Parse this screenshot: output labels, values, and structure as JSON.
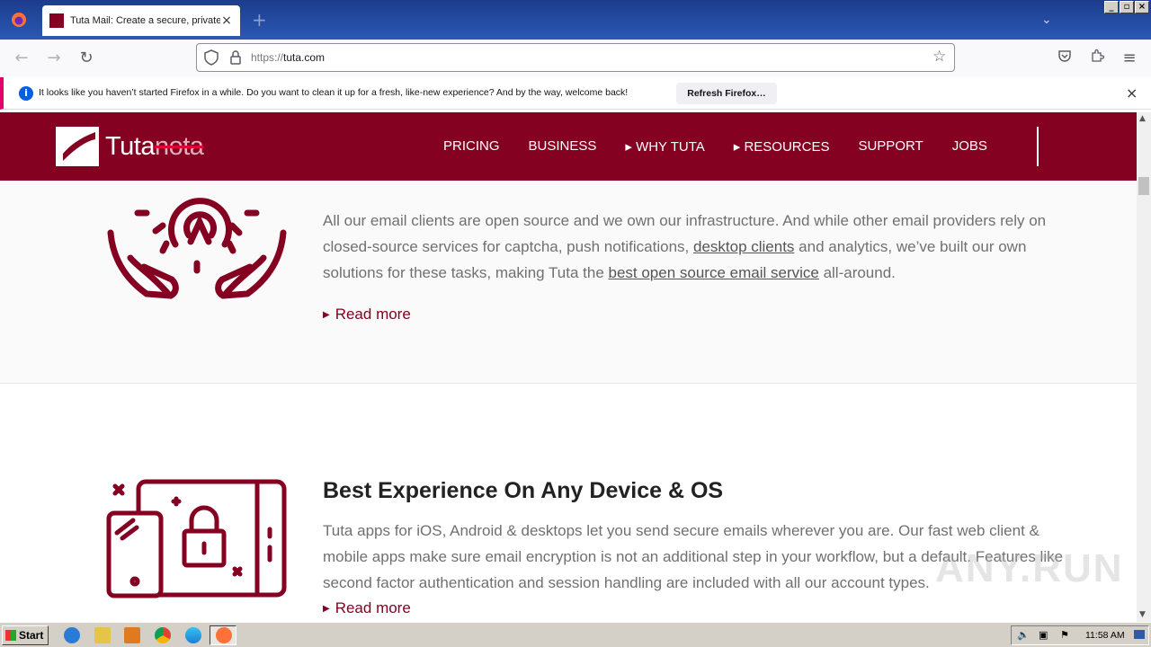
{
  "browser": {
    "tab_title": "Tuta Mail: Create a secure, private",
    "url_scheme": "https://",
    "url_host": "tuta.com",
    "notification_text": "It looks like you haven’t started Firefox in a while. Do you want to clean it up for a fresh, like-new experience? And by the way, welcome back!",
    "notification_button": "Refresh Firefox…"
  },
  "site": {
    "logo_main": "Tuta",
    "logo_struck": "nota",
    "nav": [
      "PRICING",
      "BUSINESS",
      "▸ WHY TUTA",
      "▸ RESOURCES",
      "SUPPORT",
      "JOBS"
    ],
    "brand_color": "#850122"
  },
  "section1": {
    "text_before_link1": "All our email clients are open source and we own our infrastructure. And while other email providers rely on closed-source services for captcha, push notifications, ",
    "link1": "desktop clients",
    "text_mid": " and analytics, we’ve built our own solutions for these tasks, making Tuta the ",
    "link2": "best open source email service",
    "text_end": " all-around.",
    "read_more": "Read more"
  },
  "section2": {
    "heading": "Best Experience On Any Device & OS",
    "text": "Tuta apps for iOS, Android & desktops let you send secure emails wherever you are. Our fast web client & mobile apps make sure email encryption is not an additional step in your workflow, but a default. Features like second factor authentication and session handling are included with all our account types.",
    "read_more": "Read more"
  },
  "watermark": "ANY.RUN",
  "taskbar": {
    "start_label": "Start",
    "clock": "11:58 AM"
  }
}
